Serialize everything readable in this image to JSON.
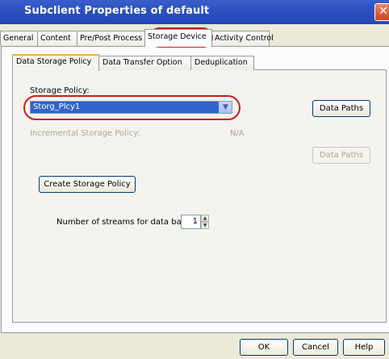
{
  "window": {
    "title": "Subclient Properties of default",
    "close_glyph": "✕"
  },
  "outer_tabs": [
    {
      "label": "General",
      "active": false
    },
    {
      "label": "Content",
      "active": false
    },
    {
      "label": "Pre/Post Process",
      "active": false
    },
    {
      "label": "Storage Device",
      "active": true
    },
    {
      "label": "Activity Control",
      "active": false
    }
  ],
  "inner_tabs": [
    {
      "label": "Data Storage Policy",
      "active": true
    },
    {
      "label": "Data Transfer Option",
      "active": false
    },
    {
      "label": "Deduplication",
      "active": false
    }
  ],
  "storage_policy": {
    "label": "Storage Policy:",
    "selected": "Storg_Plcy1",
    "data_paths_label": "Data Paths"
  },
  "incremental": {
    "label": "Incremental Storage Policy:",
    "value": "N/A",
    "data_paths_label": "Data Paths"
  },
  "create_policy_label": "Create Storage Policy",
  "streams": {
    "label": "Number of streams for data backup:",
    "value": "1"
  },
  "footer": {
    "ok_label": "OK",
    "cancel_label": "Cancel",
    "help_label": "Help"
  },
  "colors": {
    "title_bar": "#2b50c0",
    "highlight_ring": "#c81d1d",
    "selection": "#3164c9"
  }
}
